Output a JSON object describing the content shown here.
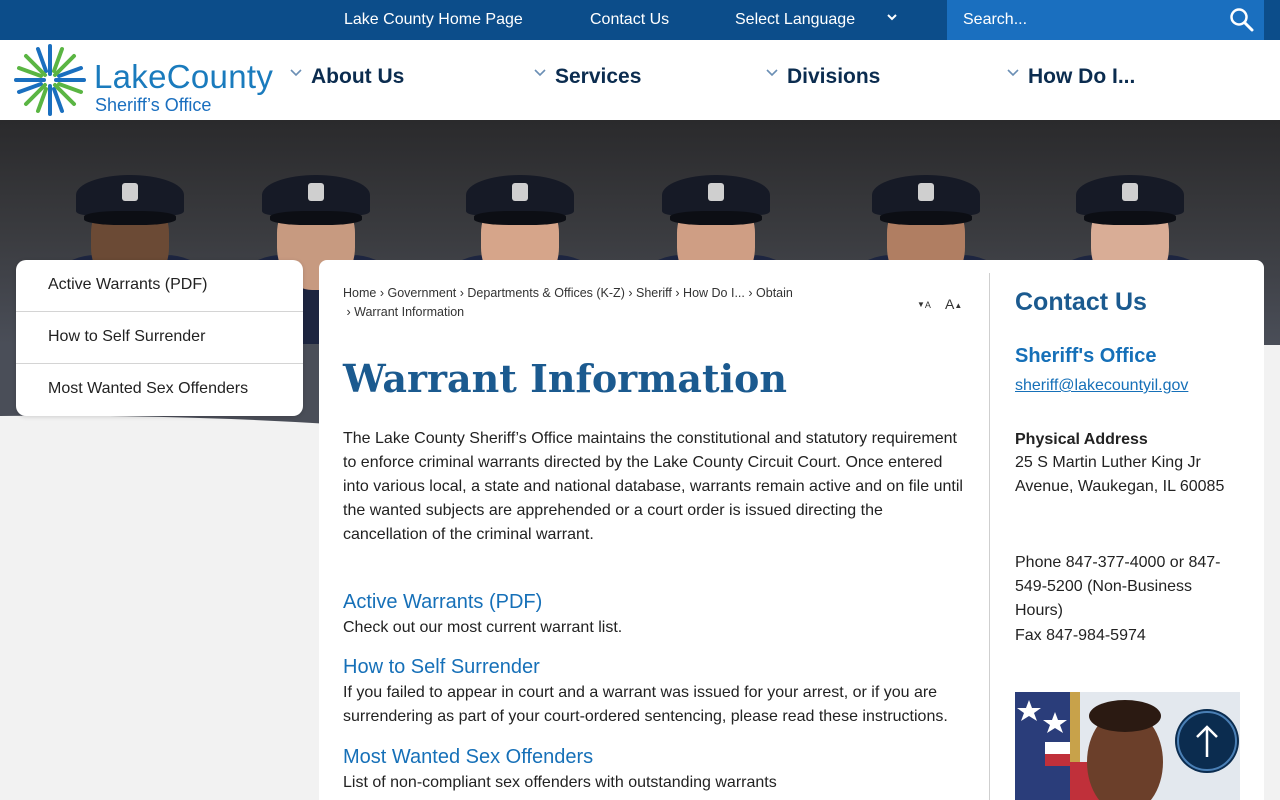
{
  "topbar": {
    "home_link": "Lake County Home Page",
    "contact_link": "Contact Us",
    "language_label": "Select Language",
    "search_placeholder": "Search..."
  },
  "logo": {
    "name_part1": "Lake",
    "name_part2": "County",
    "subtitle": "Sheriff’s Office"
  },
  "nav": {
    "items": [
      {
        "label": "About Us"
      },
      {
        "label": "Services"
      },
      {
        "label": "Divisions"
      },
      {
        "label": "How Do I..."
      }
    ]
  },
  "sidenav": {
    "items": [
      {
        "label": "Active Warrants (PDF)"
      },
      {
        "label": "How to Self Surrender"
      },
      {
        "label": "Most Wanted Sex Offenders"
      }
    ]
  },
  "breadcrumb": {
    "items": [
      "Home",
      "Government",
      "Departments & Offices (K-Z)",
      "Sheriff",
      "How Do I...",
      "Obtain",
      "Warrant Information"
    ],
    "separator": "›"
  },
  "font_tools": {
    "decrease": "A",
    "increase": "A"
  },
  "page": {
    "title": "Warrant Information",
    "intro": "The Lake County Sheriff’s Office maintains the constitutional and statutory requirement to enforce criminal warrants directed by the Lake County Circuit Court. Once entered into various local, a state and national database, warrants remain active and on file until the wanted subjects are apprehended or a court order is issued directing the cancellation of the criminal warrant.",
    "links": [
      {
        "title": "Active Warrants (PDF)",
        "desc": "Check out our most current warrant list."
      },
      {
        "title": "How to Self Surrender",
        "desc": "If you failed to appear in court and a warrant was issued for your arrest, or if you are surrendering as part of your court-ordered sentencing, please read these instructions."
      },
      {
        "title": "Most Wanted Sex Offenders",
        "desc": "List of non-compliant sex offenders with outstanding warrants"
      }
    ]
  },
  "contact": {
    "title": "Contact Us",
    "office": "Sheriff's Office",
    "email": "sheriff@lakecountyil.gov",
    "address_label": "Physical Address",
    "address": "25 S Martin Luther King Jr Avenue, Waukegan, IL 60085",
    "phone": "Phone 847-377-4000 or 847-549-5200 (Non-Business Hours)",
    "fax": "Fax 847-984-5974"
  },
  "colors": {
    "topbar": "#0c4d8a",
    "search": "#1a6fbf",
    "heading": "#1b5a8f",
    "link": "#1670b8",
    "nav_text": "#0b2c4f",
    "logo_green": "#5ab543"
  },
  "icons": {
    "search": "search-icon",
    "language_chevron": "chevron-down-icon",
    "back_to_top": "arrow-up-icon",
    "logo": "starburst-logo-icon"
  }
}
